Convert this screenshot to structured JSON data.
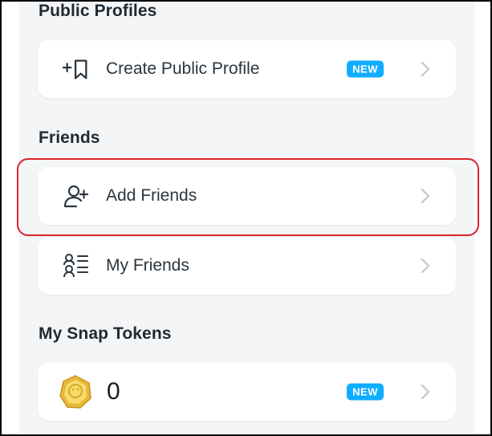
{
  "sections": {
    "public_profiles": {
      "title": "Public Profiles",
      "create_profile_label": "Create Public Profile",
      "create_profile_badge": "NEW"
    },
    "friends": {
      "title": "Friends",
      "add_friends_label": "Add Friends",
      "my_friends_label": "My Friends"
    },
    "snap_tokens": {
      "title": "My Snap Tokens",
      "token_count": "0",
      "badge": "NEW"
    }
  },
  "colors": {
    "badge_blue": "#0fadff",
    "highlight_red": "#d8232a",
    "text_dark": "#1f2a33",
    "chevron_grey": "#c9ced4"
  },
  "icons": {
    "create_profile": "bookmark-plus-icon",
    "add_friends": "person-plus-icon",
    "my_friends": "friends-list-icon",
    "snap_token": "snap-token-coin-icon",
    "chevron": "chevron-right-icon"
  }
}
